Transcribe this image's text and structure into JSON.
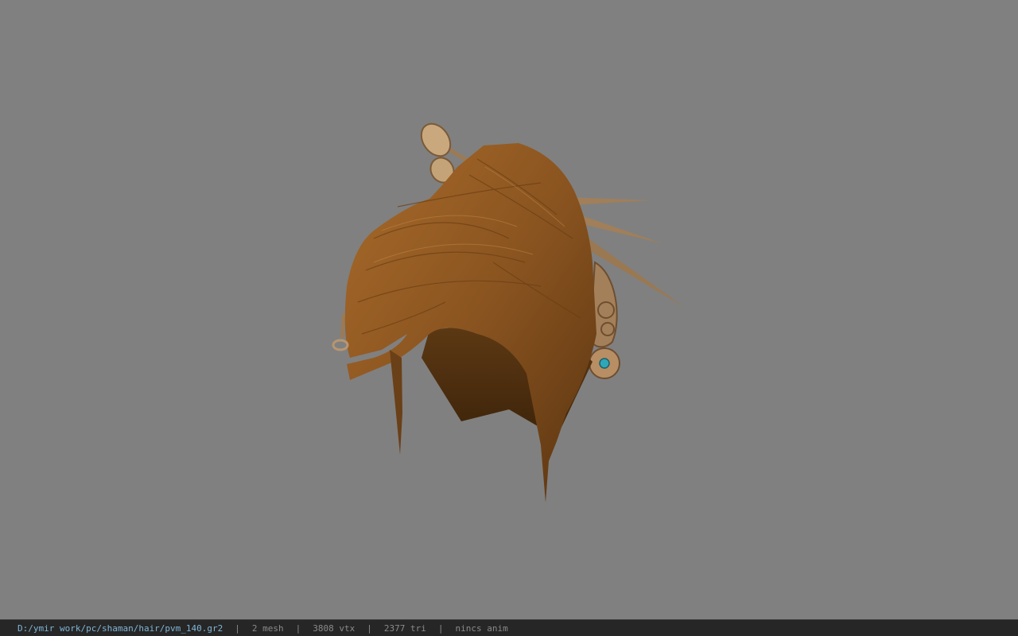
{
  "viewport": {
    "background": "#808080",
    "model_icon": "hair-mesh"
  },
  "status": {
    "file_path": "D:/ymir work/pc/shaman/hair/pvm_140.gr2",
    "mesh": "2 mesh",
    "vertices": "3808 vtx",
    "triangles": "2377 tri",
    "anim": "nincs anim",
    "separator": "|",
    "path_color": "#7fb6d6"
  }
}
